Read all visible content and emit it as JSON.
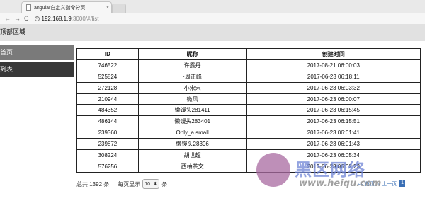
{
  "browser": {
    "tab_title": "angular自定义指令分页",
    "tab_close": "×",
    "url_host": "192.168.1.9",
    "url_rest": ":3000/#/list",
    "back": "←",
    "forward": "→",
    "reload": "C"
  },
  "topbar": {
    "title": "顶部区域"
  },
  "sidebar": {
    "items": [
      {
        "label": "首页"
      },
      {
        "label": "列表"
      }
    ]
  },
  "table": {
    "headers": [
      "ID",
      "昵称",
      "创建时间"
    ],
    "rows": [
      [
        "746522",
        "许露丹",
        "2017-08-21 06:00:03"
      ],
      [
        "525824",
        "·周正峰",
        "2017-06-23 06:18:11"
      ],
      [
        "272128",
        "小宋宋",
        "2017-06-23 06:03:32"
      ],
      [
        "210944",
        "微风",
        "2017-06-23 06:00:07"
      ],
      [
        "484352",
        "懒馒头281411",
        "2017-06-23 06:15:45"
      ],
      [
        "486144",
        "懒馒头283401",
        "2017-06-23 06:15:51"
      ],
      [
        "239360",
        "Only_a small",
        "2017-06-23 06:01:41"
      ],
      [
        "239872",
        "懒馒头28396",
        "2017-06-23 06:01:43"
      ],
      [
        "308224",
        "胡世超",
        "2017-06-23 06:05:34"
      ],
      [
        "576256",
        "西柚茶文",
        "2017-06-23 06:02:23"
      ]
    ]
  },
  "footer": {
    "total": "总共 1392 条",
    "per_page_label": "每页显示",
    "per_page_value": "10",
    "per_page_unit": "条",
    "pager": {
      "first": "<< 首页",
      "prev": "< 上一页",
      "current": "1"
    }
  },
  "watermark": {
    "text": "黑区网络",
    "url": "www.heiqu.com"
  }
}
